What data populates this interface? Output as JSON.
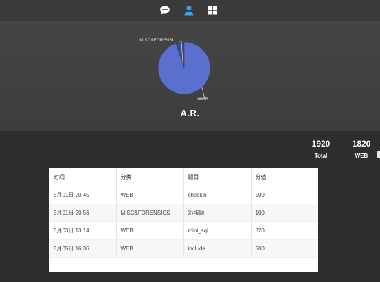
{
  "nav": {
    "icons": [
      "chat-icon",
      "user-icon",
      "grid-icon"
    ],
    "active_color": "#3ea0e6",
    "icon_color": "#ffffff"
  },
  "team": {
    "name": "A.R."
  },
  "chart_data": {
    "type": "pie",
    "labels": [
      "MISC&FORENSI...",
      "WEB"
    ],
    "values": [
      100,
      1820
    ],
    "colors": [
      "#3a4a8a",
      "#5b6fcf"
    ]
  },
  "stats": [
    {
      "value": "1920",
      "label": "Total"
    },
    {
      "value": "1820",
      "label": "WEB"
    }
  ],
  "table": {
    "headers": [
      "时间",
      "分类",
      "题目",
      "分值"
    ],
    "rows": [
      [
        "5月01日 20:45",
        "WEB",
        "checkin",
        "500"
      ],
      [
        "5月01日 20:56",
        "MISC&FORENSICS",
        "彩蛋题",
        "100"
      ],
      [
        "5月03日 13:14",
        "WEB",
        "mini_sql",
        "820"
      ],
      [
        "5月05日 16:36",
        "WEB",
        "include",
        "500"
      ]
    ]
  }
}
